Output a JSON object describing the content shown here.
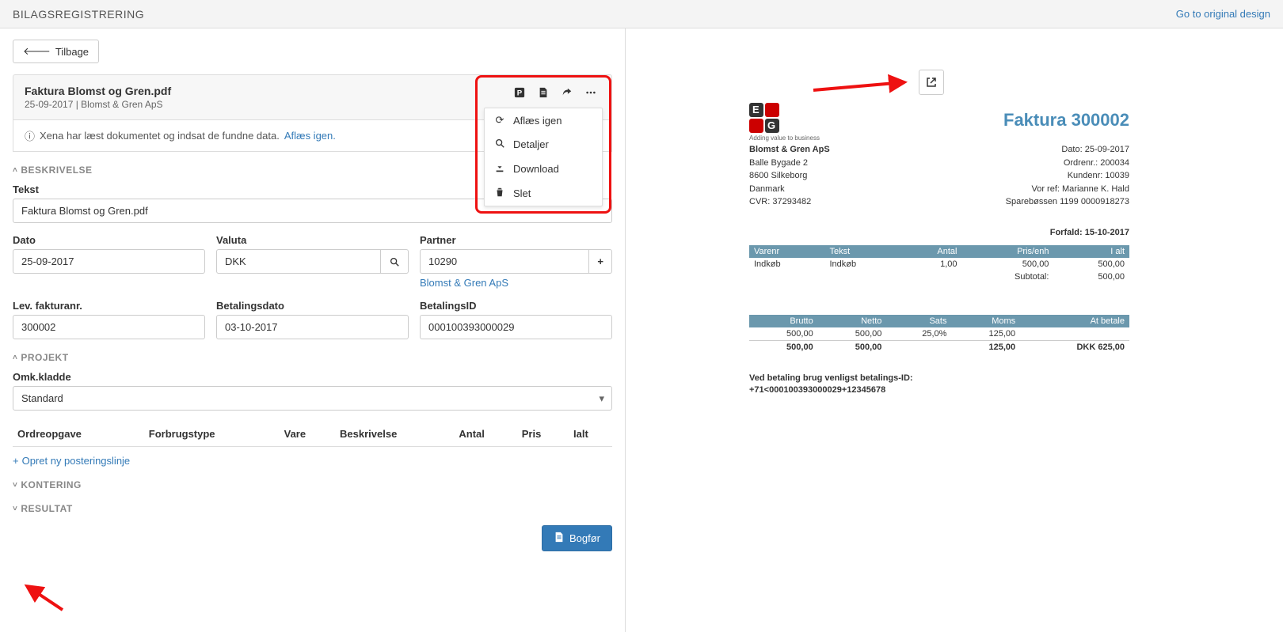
{
  "topbar": {
    "title": "BILAGSREGISTRERING",
    "link": "Go to original design"
  },
  "back": "Tilbage",
  "file": {
    "title": "Faktura Blomst og Gren.pdf",
    "sub": "25-09-2017 | Blomst & Gren ApS"
  },
  "info": {
    "text": "Xena har læst dokumentet og indsat de fundne data.",
    "link": "Aflæs igen."
  },
  "dropdown": {
    "reread": "Aflæs igen",
    "details": "Detaljer",
    "download": "Download",
    "delete": "Slet"
  },
  "sections": {
    "beskrivelse": "BESKRIVELSE",
    "projekt": "PROJEKT",
    "kontering": "KONTERING",
    "resultat": "RESULTAT"
  },
  "labels": {
    "tekst": "Tekst",
    "dato": "Dato",
    "valuta": "Valuta",
    "partner": "Partner",
    "levfaktura": "Lev. fakturanr.",
    "betalingsdato": "Betalingsdato",
    "betalingsid": "BetalingsID",
    "omkkladde": "Omk.kladde"
  },
  "values": {
    "tekst": "Faktura Blomst og Gren.pdf",
    "dato": "25-09-2017",
    "valuta": "DKK",
    "partner": "10290",
    "partner_name": "Blomst & Gren ApS",
    "levfaktura": "300002",
    "betalingsdato": "03-10-2017",
    "betalingsid": "000100393000029",
    "omkkladde": "Standard"
  },
  "line_headers": [
    "Ordreopgave",
    "Forbrugstype",
    "Vare",
    "Beskrivelse",
    "Antal",
    "Pris",
    "Ialt"
  ],
  "add_line": "Opret ny posteringslinje",
  "post": "Bogfør",
  "doc": {
    "logo_tag": "Adding value to business",
    "inv_title": "Faktura 300002",
    "company": "Blomst & Gren ApS",
    "addr1": "Balle Bygade 2",
    "addr2": "8600 Silkeborg",
    "addr3": "Danmark",
    "cvr": "CVR: 37293482",
    "date": "Dato: 25-09-2017",
    "ordernr": "Ordrenr.: 200034",
    "kundenr": "Kundenr: 10039",
    "vorref": "Vor ref: Marianne K. Hald",
    "spare": "Sparebøssen 1199 0000918273",
    "forfald": "Forfald: 15-10-2017",
    "t1_head": [
      "Varenr",
      "Tekst",
      "Antal",
      "Pris/enh",
      "I alt"
    ],
    "t1_row": [
      "Indkøb",
      "Indkøb",
      "1,00",
      "500,00",
      "500,00"
    ],
    "subtotal_label": "Subtotal:",
    "subtotal_val": "500,00",
    "t2_head": [
      "Brutto",
      "Netto",
      "Sats",
      "Moms",
      "At betale"
    ],
    "t2_r1": [
      "500,00",
      "500,00",
      "25,0%",
      "125,00",
      ""
    ],
    "t2_r2": [
      "500,00",
      "500,00",
      "",
      "125,00",
      "DKK 625,00"
    ],
    "paynote1": "Ved betaling brug venligst betalings-ID:",
    "paynote2": "+71<000100393000029+12345678"
  }
}
